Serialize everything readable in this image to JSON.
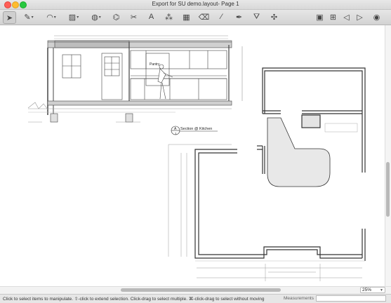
{
  "window": {
    "title": "Export for SU demo.layout- Page 1"
  },
  "toolbar": {
    "tools": [
      {
        "name": "select-tool",
        "glyph": "➤",
        "dropdown": false
      },
      {
        "name": "pencil-tool",
        "glyph": "✎",
        "dropdown": true
      },
      {
        "name": "arc-tool",
        "glyph": "◠",
        "dropdown": true
      },
      {
        "name": "rectangle-tool",
        "glyph": "▨",
        "dropdown": true
      },
      {
        "name": "circle-tool",
        "glyph": "◍",
        "dropdown": true
      },
      {
        "name": "offset-tool",
        "glyph": "⌬",
        "dropdown": false
      },
      {
        "name": "scissors-tool",
        "glyph": "✂",
        "dropdown": false
      },
      {
        "name": "text-tool",
        "glyph": "A",
        "dropdown": false
      },
      {
        "name": "label-tool",
        "glyph": "⁂",
        "dropdown": false
      },
      {
        "name": "table-tool",
        "glyph": "▦",
        "dropdown": false
      },
      {
        "name": "eraser-tool",
        "glyph": "⌫",
        "dropdown": false
      },
      {
        "name": "style-picker-tool",
        "glyph": "⁄",
        "dropdown": false
      },
      {
        "name": "paint-tool",
        "glyph": "✒",
        "dropdown": false
      },
      {
        "name": "join-tool",
        "glyph": "⛛",
        "dropdown": false
      },
      {
        "name": "split-tool",
        "glyph": "✣",
        "dropdown": false
      }
    ],
    "right_tools": [
      {
        "name": "presentation-tool",
        "glyph": "▣"
      },
      {
        "name": "add-page-tool",
        "glyph": "⊞"
      },
      {
        "name": "previous-page-tool",
        "glyph": "◁"
      },
      {
        "name": "next-page-tool",
        "glyph": "▷"
      },
      {
        "name": "user-account-tool",
        "glyph": "◉"
      }
    ]
  },
  "drawing": {
    "pantry_label": "Pantry",
    "section_tag": "A",
    "section_sheet": "1",
    "section_title": "Section @ Kitchen"
  },
  "zoom": {
    "value": "25%"
  },
  "status": {
    "hint": "Click to select items to manipulate. ⇧-click to extend selection. Click-drag to select multiple. ⌘-click-drag to select without moving",
    "measurements_label": "Measurements",
    "measurements_value": ""
  }
}
